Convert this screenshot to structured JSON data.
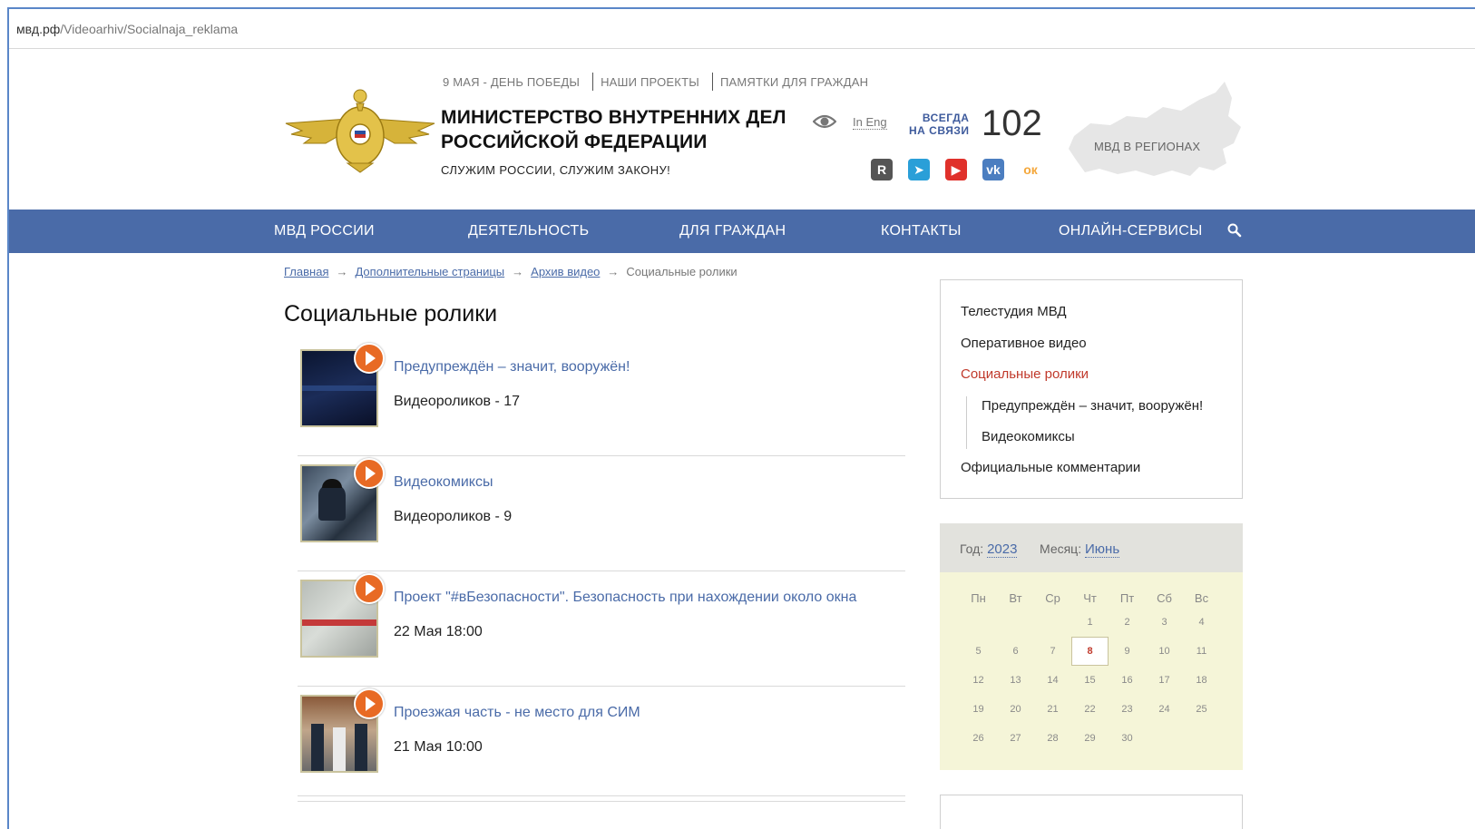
{
  "browser": {
    "url_domain": "мвд.рф",
    "url_path": "/Videoarhiv/Socialnaja_reklama"
  },
  "header": {
    "top_links": [
      "9 МАЯ - ДЕНЬ ПОБЕДЫ",
      "НАШИ ПРОЕКТЫ",
      "ПАМЯТКИ ДЛЯ ГРАЖДАН"
    ],
    "ministry_line1": "МИНИСТЕРСТВО ВНУТРЕННИХ ДЕЛ",
    "ministry_line2": "РОССИЙСКОЙ ФЕДЕРАЦИИ",
    "motto": "СЛУЖИМ РОССИИ, СЛУЖИМ ЗАКОНУ!",
    "lang_link": "In Eng",
    "always_line1": "ВСЕГДА",
    "always_line2": "НА СВЯЗИ",
    "phone": "102",
    "regions_label": "МВД В РЕГИОНАХ",
    "socials": [
      {
        "name": "rutube-icon",
        "glyph": "R",
        "color": "#555555"
      },
      {
        "name": "telegram-icon",
        "glyph": "➤",
        "color": "#2a9fd8"
      },
      {
        "name": "youtube-icon",
        "glyph": "▶",
        "color": "#e0312b"
      },
      {
        "name": "vk-icon",
        "glyph": "vk",
        "color": "#4c7ec0"
      },
      {
        "name": "odnoklassniki-icon",
        "glyph": "ок",
        "color": "#f4a73b"
      }
    ]
  },
  "nav": {
    "items": [
      "МВД РОССИИ",
      "ДЕЯТЕЛЬНОСТЬ",
      "ДЛЯ ГРАЖДАН",
      "КОНТАКТЫ",
      "ОНЛАЙН-СЕРВИСЫ"
    ]
  },
  "breadcrumb": {
    "items": [
      "Главная",
      "Дополнительные страницы",
      "Архив видео"
    ],
    "current": "Социальные ролики",
    "separator": "→"
  },
  "page_title": "Социальные ролики",
  "videos": [
    {
      "title": "Предупреждён – значит, вооружён!",
      "meta": "Видеороликов - 17"
    },
    {
      "title": "Видеокомиксы",
      "meta": "Видеороликов - 9"
    },
    {
      "title": "Проект \"#вБезопасности\". Безопасность при нахождении около окна",
      "meta": "22 Мая 18:00"
    },
    {
      "title": "Проезжая часть - не место для СИМ",
      "meta": "21 Мая 10:00"
    }
  ],
  "sidebar": {
    "items": [
      "Телестудия МВД",
      "Оперативное видео",
      "Социальные ролики",
      "Официальные комментарии"
    ],
    "subitems": [
      "Предупреждён – значит, вооружён!",
      "Видеокомиксы"
    ]
  },
  "calendar": {
    "year_label": "Год:",
    "year": "2023",
    "month_label": "Месяц:",
    "month": "Июнь",
    "weekdays": [
      "Пн",
      "Вт",
      "Ср",
      "Чт",
      "Пт",
      "Сб",
      "Вс"
    ],
    "weeks": [
      [
        "",
        "",
        "",
        "1",
        "2",
        "3",
        "4"
      ],
      [
        "5",
        "6",
        "7",
        "8",
        "9",
        "10",
        "11"
      ],
      [
        "12",
        "13",
        "14",
        "15",
        "16",
        "17",
        "18"
      ],
      [
        "19",
        "20",
        "21",
        "22",
        "23",
        "24",
        "25"
      ],
      [
        "26",
        "27",
        "28",
        "29",
        "30",
        "",
        ""
      ]
    ],
    "today": "8"
  }
}
